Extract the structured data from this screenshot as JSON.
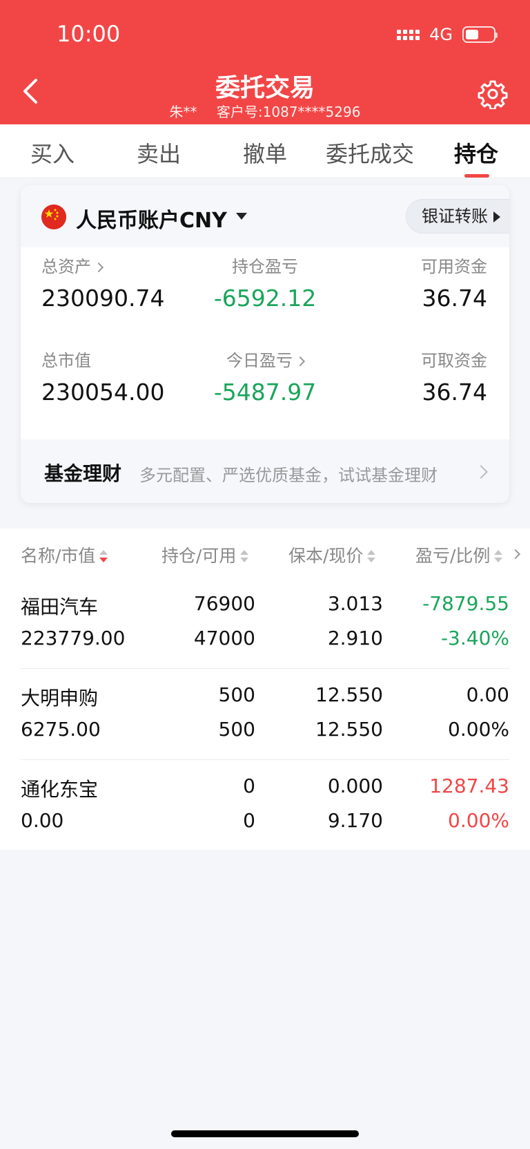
{
  "status_bar": {
    "time": "10:00",
    "network": "4G"
  },
  "header": {
    "title": "委托交易",
    "user": "朱**",
    "customer_id": "客户号:1087****5296"
  },
  "tabs": [
    {
      "label": "买入",
      "active": false
    },
    {
      "label": "卖出",
      "active": false
    },
    {
      "label": "撤单",
      "active": false
    },
    {
      "label": "委托成交",
      "active": false
    },
    {
      "label": "持仓",
      "active": true
    }
  ],
  "account": {
    "name": "人民币账户CNY",
    "transfer_label": "银证转账",
    "total_assets_label": "总资产",
    "total_assets": "230090.74",
    "position_pnl_label": "持仓盈亏",
    "position_pnl": "-6592.12",
    "available_label": "可用资金",
    "available": "36.74",
    "market_value_label": "总市值",
    "market_value": "230054.00",
    "today_pnl_label": "今日盈亏",
    "today_pnl": "-5487.97",
    "withdrawable_label": "可取资金",
    "withdrawable": "36.74"
  },
  "fund": {
    "title": "基金理财",
    "desc": "多元配置、严选优质基金，试试基金理财"
  },
  "table": {
    "headers": [
      "名称/市值",
      "持仓/可用",
      "保本/现价",
      "盈亏/比例"
    ],
    "rows": [
      {
        "name": "福田汽车",
        "value": "223779.00",
        "position": "76900",
        "available": "47000",
        "cost": "3.013",
        "price": "2.910",
        "pnl": "-7879.55",
        "ratio": "-3.40%",
        "pnl_color": "#1aa55a"
      },
      {
        "name": "大明申购",
        "value": "6275.00",
        "position": "500",
        "available": "500",
        "cost": "12.550",
        "price": "12.550",
        "pnl": "0.00",
        "ratio": "0.00%",
        "pnl_color": "#111111"
      },
      {
        "name": "通化东宝",
        "value": "0.00",
        "position": "0",
        "available": "0",
        "cost": "0.000",
        "price": "9.170",
        "pnl": "1287.43",
        "ratio": "0.00%",
        "pnl_color": "#f24646"
      }
    ]
  },
  "colors": {
    "brand": "#f24646",
    "gain": "#f24646",
    "loss": "#1aa55a"
  }
}
